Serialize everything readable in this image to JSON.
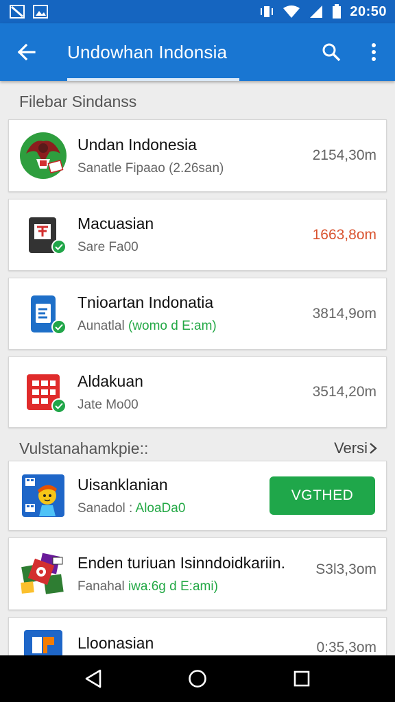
{
  "status_bar": {
    "time": "20:50",
    "icons": [
      "notification-icon",
      "image-icon",
      "vibrate-icon",
      "wifi-icon",
      "signal-icon",
      "battery-icon"
    ]
  },
  "app_bar": {
    "title": "Undowhan Indonsia",
    "actions": [
      "back-arrow-icon",
      "search-icon",
      "overflow-menu-icon"
    ]
  },
  "section1": {
    "title": "Filebar Sindanss"
  },
  "apps": [
    {
      "name": "Undan Indonesia",
      "sub": "Sanatle Fipaao (2.26san)",
      "sub_green": "",
      "size": "2154,30m",
      "size_color": "gray",
      "icon": "garuda-app-icon"
    },
    {
      "name": "Macuasian",
      "sub": "Sare Fa00",
      "sub_green": "",
      "size": "1663,8om",
      "size_color": "red",
      "icon": "dark-app-icon"
    },
    {
      "name": "Tnioartan Indonatia",
      "sub": "Aunatlal ",
      "sub_green": "(womo d E:am)",
      "size": "3814,9om",
      "size_color": "gray",
      "icon": "blue-app-icon"
    },
    {
      "name": "Aldakuan",
      "sub": "Jate Mo00",
      "sub_green": "",
      "size": "3514,20m",
      "size_color": "gray",
      "icon": "red-grid-app-icon"
    }
  ],
  "section2": {
    "title": "Vulstanahamkpie::",
    "more": "Versi"
  },
  "apps2": [
    {
      "name": "Uisanklanian",
      "sub": "Sanadol : ",
      "sub_green": "AloaDa0",
      "button": "VGTHED",
      "icon": "cartoon-app-icon"
    },
    {
      "name": "Enden turiuan Isinndoidkariin.",
      "sub": "Fanahal ",
      "sub_green": "iwa:6g d E:ami)",
      "size": "S3l3,3om",
      "icon": "colorful-app-icon"
    },
    {
      "name": "Lloonasian",
      "size": "0:35,3om",
      "icon": "orange-blue-app-icon"
    }
  ],
  "colors": {
    "appbar": "#1976d2",
    "statusbar": "#1565c0",
    "accent_green": "#1fa74a",
    "size_red": "#d9532f"
  },
  "nav_bar": [
    "back-triangle-icon",
    "home-circle-icon",
    "recents-square-icon"
  ]
}
